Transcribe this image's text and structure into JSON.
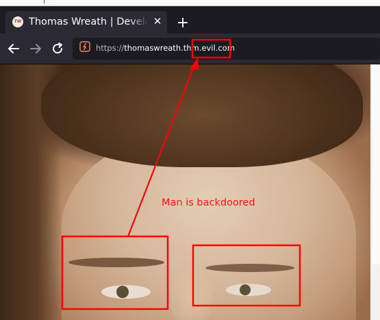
{
  "tab": {
    "favicon_text": "TW",
    "title": "Thomas Wreath | Developer",
    "close_glyph": "✕",
    "new_tab_glyph": "+"
  },
  "nav": {
    "back_icon": "arrow-left-icon",
    "forward_icon": "arrow-right-icon",
    "reload_icon": "reload-icon"
  },
  "address": {
    "scheme": "https://",
    "host": "thomaswreath.thm.evil.com"
  },
  "annotation": {
    "text": "Man is backdoored",
    "color": "#ff0000"
  },
  "colors": {
    "tab_bar": "#1c1b22",
    "tab_active": "#2b2a33",
    "url_field": "#1c1b22",
    "annotation_red": "#ff0000"
  }
}
